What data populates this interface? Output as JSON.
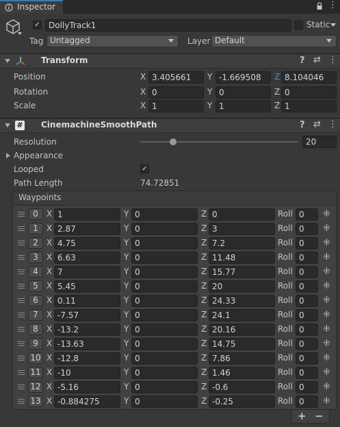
{
  "tab": {
    "title": "Inspector"
  },
  "gameobject": {
    "name": "DollyTrack1",
    "active": true,
    "static_label": "Static",
    "tag_label": "Tag",
    "tag_value": "Untagged",
    "layer_label": "Layer",
    "layer_value": "Default"
  },
  "transform": {
    "title": "Transform",
    "rows": [
      {
        "label": "Position",
        "x": "3.405661",
        "y": "-1.669508",
        "z": "8.104046"
      },
      {
        "label": "Rotation",
        "x": "0",
        "y": "0",
        "z": "0"
      },
      {
        "label": "Scale",
        "x": "1",
        "y": "1",
        "z": "1"
      }
    ]
  },
  "path": {
    "title": "CinemachineSmoothPath",
    "script_icon": "#",
    "resolution_label": "Resolution",
    "resolution_value": "20",
    "appearance_label": "Appearance",
    "looped_label": "Looped",
    "looped": true,
    "path_length_label": "Path Length",
    "path_length_value": "74.72851",
    "waypoints_label": "Waypoints",
    "roll_label": "Roll",
    "waypoints": [
      {
        "i": "0",
        "x": "1",
        "y": "0",
        "z": "0",
        "roll": "0"
      },
      {
        "i": "1",
        "x": "2.87",
        "y": "0",
        "z": "3",
        "roll": "0"
      },
      {
        "i": "2",
        "x": "4.75",
        "y": "0",
        "z": "7.2",
        "roll": "0"
      },
      {
        "i": "3",
        "x": "6.63",
        "y": "0",
        "z": "11.48",
        "roll": "0"
      },
      {
        "i": "4",
        "x": "7",
        "y": "0",
        "z": "15.77",
        "roll": "0"
      },
      {
        "i": "5",
        "x": "5.45",
        "y": "0",
        "z": "20",
        "roll": "0"
      },
      {
        "i": "6",
        "x": "0.11",
        "y": "0",
        "z": "24.33",
        "roll": "0"
      },
      {
        "i": "7",
        "x": "-7.57",
        "y": "0",
        "z": "24.1",
        "roll": "0"
      },
      {
        "i": "8",
        "x": "-13.2",
        "y": "0",
        "z": "20.16",
        "roll": "0"
      },
      {
        "i": "9",
        "x": "-13.63",
        "y": "0",
        "z": "14.75",
        "roll": "0"
      },
      {
        "i": "10",
        "x": "-12.8",
        "y": "0",
        "z": "7.86",
        "roll": "0"
      },
      {
        "i": "11",
        "x": "-10",
        "y": "0",
        "z": "1.46",
        "roll": "0"
      },
      {
        "i": "12",
        "x": "-5.16",
        "y": "0",
        "z": "-0.6",
        "roll": "0"
      },
      {
        "i": "13",
        "x": "-0.884275",
        "y": "0",
        "z": "-0.25",
        "roll": "0"
      }
    ]
  },
  "axes": {
    "x": "X",
    "y": "Y",
    "z": "Z"
  },
  "colors": {
    "tab_accent": "#3a79bb",
    "panel_bg": "#383838",
    "field_bg": "#2a2a2a"
  }
}
